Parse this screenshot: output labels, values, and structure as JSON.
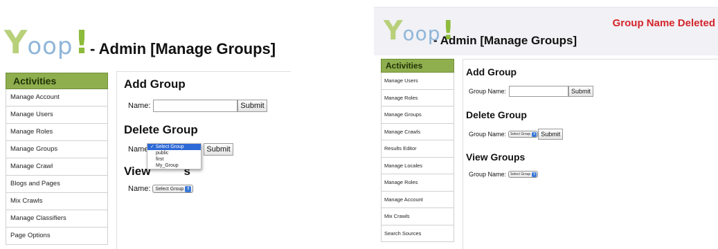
{
  "left": {
    "logo": {
      "y": "Y",
      "oop": "oop",
      "bang": "!"
    },
    "page_title": "- Admin [Manage Groups]",
    "sidebar": {
      "heading": "Activities",
      "items": [
        "Manage Account",
        "Manage Users",
        "Manage Roles",
        "Manage Groups",
        "Manage Crawl",
        "Blogs and Pages",
        "Mix Crawls",
        "Manage Classifiers",
        "Page Options"
      ]
    },
    "add_group": {
      "title": "Add Group",
      "label": "Name:",
      "value": "",
      "submit": "Submit"
    },
    "delete_group": {
      "title": "Delete Group",
      "label": "Name:",
      "submit": "Submit",
      "dropdown": {
        "selected": "✓ Select Group",
        "options": [
          "public",
          "first",
          "My_Group"
        ]
      }
    },
    "view_groups": {
      "title": "View Groups",
      "title_visible": "View",
      "title_tail": "s",
      "label": "Name:",
      "select": "Select Group"
    }
  },
  "right": {
    "logo": {
      "y": "Y",
      "oop": "oop",
      "bang": "!"
    },
    "page_title": "- Admin [Manage Groups]",
    "alert": "Group Name Deleted",
    "sidebar": {
      "heading": "Activities",
      "items": [
        "Manage Users",
        "Manage Roles",
        "Manage Groups",
        "Manage Crawls",
        "Results Editor",
        "Manage Locales",
        "Manage Roles",
        "Manage Account",
        "Mix Crawls",
        "Search Sources"
      ]
    },
    "add_group": {
      "title": "Add Group",
      "label": "Group Name:",
      "value": "",
      "submit": "Submit"
    },
    "delete_group": {
      "title": "Delete Group",
      "label": "Group Name:",
      "select": "Select Group",
      "submit": "Submit"
    },
    "view_groups": {
      "title": "View Groups",
      "label": "Group Name:",
      "select": "Select Group"
    }
  },
  "colors": {
    "sidebar_heading": "#8fae4e",
    "alert": "#d4242a",
    "logo_y": "#b8d07a",
    "logo_oop": "#8fb6d9",
    "logo_bang": "#8dbb3b",
    "select_arrow": "#3a78d8"
  },
  "icons": {
    "select_arrow": "select-arrow-icon",
    "checkmark": "checkmark-icon"
  }
}
